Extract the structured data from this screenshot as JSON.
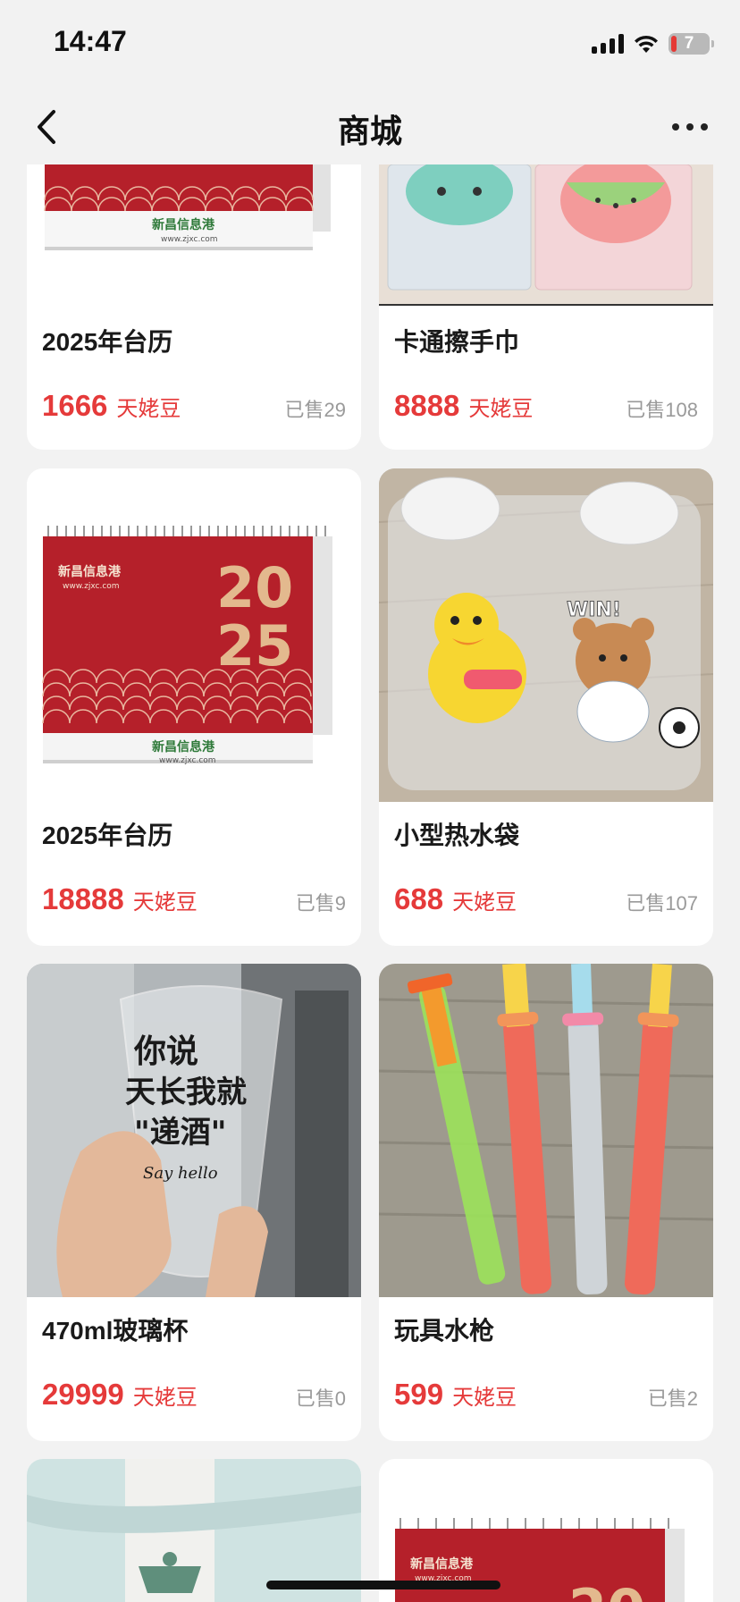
{
  "status": {
    "time": "14:47",
    "battery": "7"
  },
  "nav": {
    "title": "商城"
  },
  "products": [
    {
      "name": "2025年台历",
      "price": "1666",
      "unit": "天姥豆",
      "sold": "已售29"
    },
    {
      "name": "卡通擦手巾",
      "price": "8888",
      "unit": "天姥豆",
      "sold": "已售108"
    },
    {
      "name": "2025年台历",
      "price": "18888",
      "unit": "天姥豆",
      "sold": "已售9"
    },
    {
      "name": "小型热水袋",
      "price": "688",
      "unit": "天姥豆",
      "sold": "已售107"
    },
    {
      "name": "470ml玻璃杯",
      "price": "29999",
      "unit": "天姥豆",
      "sold": "已售0"
    },
    {
      "name": "玩具水枪",
      "price": "599",
      "unit": "天姥豆",
      "sold": "已售2"
    }
  ],
  "images": {
    "calendar_brand": "新昌信息港",
    "calendar_url": "www.zjxc.com",
    "calendar_year_top": "20",
    "calendar_year_bottom": "25",
    "bag_text": "WIN!",
    "cup_text_1": "你说",
    "cup_text_2": "天长我就",
    "cup_text_3": "\"递酒\"",
    "cup_text_4": "Say hello"
  },
  "colors": {
    "price": "#e53a3a",
    "calendar_red": "#b5202a",
    "background": "#f2f2f2"
  }
}
